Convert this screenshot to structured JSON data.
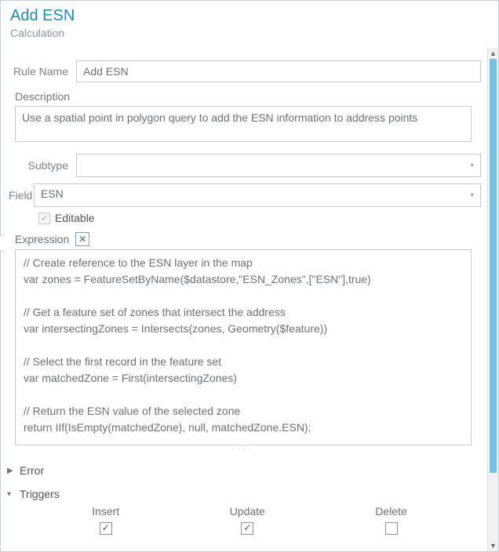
{
  "header": {
    "title": "Add ESN",
    "subtitle": "Calculation"
  },
  "form": {
    "ruleName": {
      "label": "Rule Name",
      "value": "Add ESN"
    },
    "description": {
      "label": "Description",
      "value": "Use a spatial point in polygon query to add the ESN information to address points"
    },
    "subtype": {
      "label": "Subtype",
      "value": ""
    },
    "field": {
      "label": "Field",
      "value": "ESN"
    },
    "editable": {
      "label": "Editable",
      "checked": true
    },
    "expression": {
      "label": "Expression",
      "code": "// Create reference to the ESN layer in the map\nvar zones = FeatureSetByName($datastore,\"ESN_Zones\",[\"ESN\"],true)\n\n// Get a feature set of zones that intersect the address\nvar intersectingZones = Intersects(zones, Geometry($feature))\n\n// Select the first record in the feature set\nvar matchedZone = First(intersectingZones)\n\n// Return the ESN value of the selected zone\nreturn IIf(IsEmpty(matchedZone), null, matchedZone.ESN);"
    }
  },
  "sections": {
    "error": {
      "label": "Error",
      "expanded": false
    },
    "triggers": {
      "label": "Triggers",
      "expanded": true,
      "items": {
        "insert": {
          "label": "Insert",
          "checked": true
        },
        "update": {
          "label": "Update",
          "checked": true
        },
        "delete": {
          "label": "Delete",
          "checked": false
        }
      }
    }
  }
}
